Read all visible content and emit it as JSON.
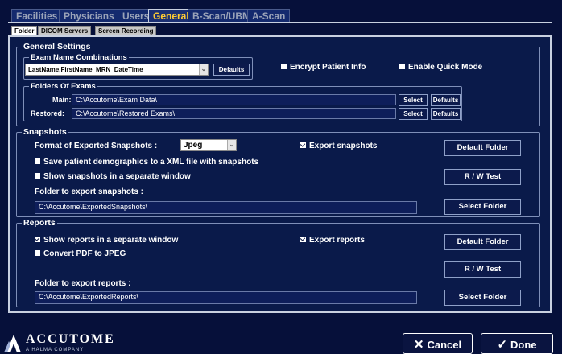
{
  "top_tabs": [
    {
      "label": "Facilities"
    },
    {
      "label": "Physicians"
    },
    {
      "label": "Users"
    },
    {
      "label": "General"
    },
    {
      "label": "B-Scan/UBM"
    },
    {
      "label": "A-Scan"
    }
  ],
  "sub_tabs": [
    {
      "label": "Folder"
    },
    {
      "label": "DICOM Servers"
    },
    {
      "label": "Screen Recording"
    }
  ],
  "general_settings": {
    "title": "General Settings",
    "exam_name_combinations": {
      "title": "Exam Name Combinations",
      "selected": "LastName,FirstName_MRN_DateTime",
      "defaults_label": "Defaults"
    },
    "encrypt_patient_info": "Encrypt Patient Info",
    "enable_quick_mode": "Enable Quick Mode",
    "folders_of_exams": {
      "title": "Folders Of Exams",
      "main_label": "Main:",
      "main_path": "C:\\Accutome\\Exam Data\\",
      "restored_label": "Restored:",
      "restored_path": "C:\\Accutome\\Restored Exams\\",
      "select_label": "Select",
      "defaults_label": "Defaults"
    }
  },
  "snapshots": {
    "title": "Snapshots",
    "format_label": "Format of Exported Snapshots :",
    "format_value": "Jpeg",
    "export_snapshots": "Export snapshots",
    "default_folder_label": "Default Folder",
    "save_demographics": "Save patient demographics to a XML file with snapshots",
    "show_separate": "Show snapshots in a separate window",
    "rw_test_label": "R / W Test",
    "folder_label": "Folder to export snapshots :",
    "folder_path": "C:\\Accutome\\ExportedSnapshots\\",
    "select_folder_label": "Select Folder"
  },
  "reports": {
    "title": "Reports",
    "show_separate": "Show reports in a separate window",
    "export_reports": "Export reports",
    "default_folder_label": "Default Folder",
    "convert_pdf": "Convert PDF to JPEG",
    "rw_test_label": "R / W Test",
    "folder_label": "Folder to export reports :",
    "folder_path": "C:\\Accutome\\ExportedReports\\",
    "select_folder_label": "Select Folder"
  },
  "footer": {
    "logo_text": "ACCUTOME",
    "logo_sub": "A HALMA COMPANY",
    "cancel_label": "Cancel",
    "done_label": "Done"
  }
}
